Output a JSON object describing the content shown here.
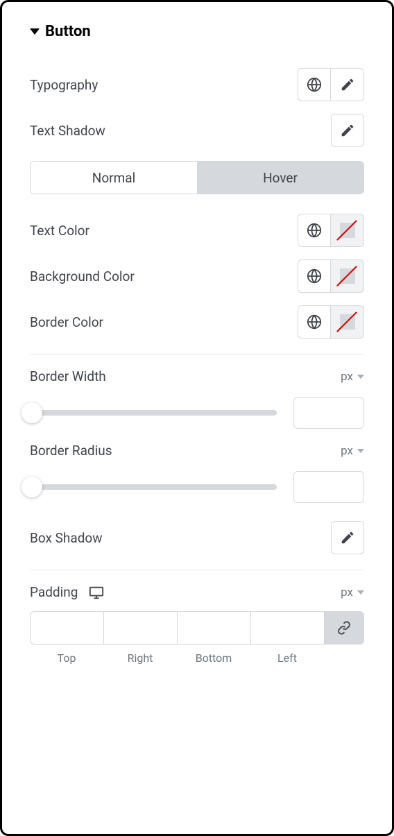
{
  "section": {
    "title": "Button"
  },
  "rows": {
    "typography": "Typography",
    "textShadow": "Text Shadow",
    "textColor": "Text Color",
    "backgroundColor": "Background Color",
    "borderColor": "Border Color",
    "borderWidth": "Border Width",
    "borderRadius": "Border Radius",
    "boxShadow": "Box Shadow",
    "padding": "Padding"
  },
  "tabs": {
    "normal": "Normal",
    "hover": "Hover",
    "active": "hover"
  },
  "units": {
    "borderWidth": "px",
    "borderRadius": "px",
    "padding": "px"
  },
  "sliders": {
    "borderWidth": "",
    "borderRadius": ""
  },
  "paddingSides": {
    "top": "Top",
    "right": "Right",
    "bottom": "Bottom",
    "left": "Left"
  },
  "paddingValues": {
    "top": "",
    "right": "",
    "bottom": "",
    "left": ""
  }
}
